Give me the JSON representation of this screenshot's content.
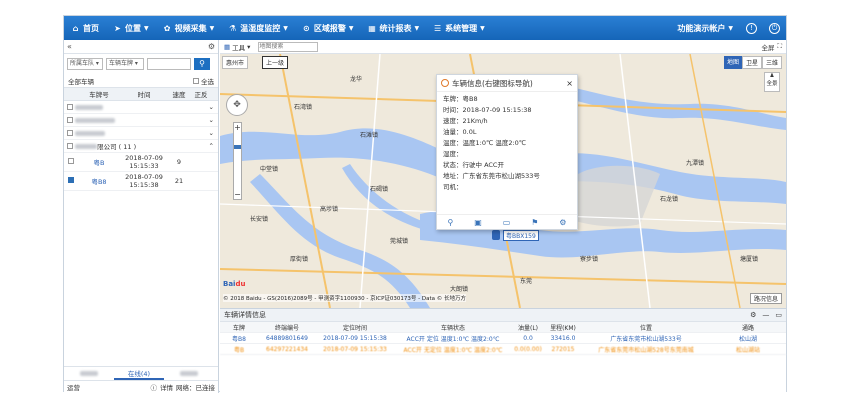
{
  "nav": {
    "items": [
      {
        "icon": "home-icon",
        "glyph": "⌂",
        "label": "首页",
        "caret": false
      },
      {
        "icon": "location-icon",
        "glyph": "➤",
        "label": "位置",
        "caret": true
      },
      {
        "icon": "video-icon",
        "glyph": "✿",
        "label": "视频采集",
        "caret": true
      },
      {
        "icon": "thermometer-icon",
        "glyph": "⚗",
        "label": "温湿度监控",
        "caret": true
      },
      {
        "icon": "region-icon",
        "glyph": "⊙",
        "label": "区域报警",
        "caret": true
      },
      {
        "icon": "report-icon",
        "glyph": "▦",
        "label": "统计报表",
        "caret": true
      },
      {
        "icon": "settings-icon",
        "glyph": "☰",
        "label": "系统管理",
        "caret": true
      }
    ],
    "account": "功能演示帐户"
  },
  "left": {
    "filter_1": "所属车队",
    "filter_2": "车辆车牌",
    "all_vehicles": "全部车辆",
    "select_all": "全选",
    "headers": [
      "车牌号",
      "时间",
      "速度",
      "正反"
    ],
    "company_group": "限公司 ( 11 )",
    "rows": [
      {
        "plate": "粤B",
        "date": "2018-07-09",
        "time": "15:15:33",
        "speed": "9",
        "checked": false
      },
      {
        "plate": "粤B8",
        "date": "2018-07-09",
        "time": "15:15:38",
        "speed": "21",
        "checked": true
      }
    ],
    "tab_online": "在线(4)",
    "status_label": "运营",
    "status_detail": "详情",
    "status_net": "网络：已连接"
  },
  "map_toolbar": {
    "tools_label": "工具",
    "search_placeholder": "地图搜索",
    "fullscreen": "全屏"
  },
  "map": {
    "tabs": [
      "地图",
      "卫星",
      "三维"
    ],
    "fullview": "全景",
    "city_tab": "惠州市",
    "level_tab": "上一级",
    "copyright": "© 2018 Baidu - GS(2016)2089号 - 甲测资字1100930 - 京ICP证030173号 - Data © 长地万方",
    "info_label": "路况信息",
    "marker_label": "粤BBX159",
    "places": [
      "石湾镇",
      "龙华",
      "石滩镇",
      "九潭镇",
      "东莞",
      "中堂镇",
      "石龙镇",
      "塘厦镇",
      "厚街镇",
      "石碣镇",
      "莞城镇",
      "高埗镇",
      "寮步镇",
      "大朗镇",
      "长安镇"
    ]
  },
  "popup": {
    "title": "车辆信息(右键图标导航)",
    "lines": [
      "车牌：粤B8",
      "时间：2018-07-09 15:15:38",
      "速度：21Km/h",
      "油量：0.0L",
      "温度：温度1:0℃ 温度2:0℃",
      "湿度：",
      "状态：行驶中 ACC开",
      "地址：广东省东莞市松山湖533号",
      "司机："
    ]
  },
  "detail": {
    "title": "车辆详情信息",
    "headers": [
      "车牌",
      "终端编号",
      "定位时间",
      "车辆状态",
      "油量(L)",
      "里程(KM)",
      "位置",
      "通路"
    ],
    "rows": [
      {
        "plate": "粤B8",
        "terminal": "64889801649",
        "time": "2018-07-09 15:15:38",
        "status": "ACC开 定位 温度1:0℃ 温度2:0℃",
        "fuel": "0.0",
        "mileage": "33416.0",
        "location": "广东省东莞市松山湖533号",
        "channel": "松山湖"
      },
      {
        "plate": "粤B",
        "terminal": "64297221434",
        "time": "2018-07-09 15:15:33",
        "status": "ACC开 无定位 温度1:0℃ 温度2:0℃",
        "fuel": "0.0(0.00)",
        "mileage": "272015",
        "location": "广东省东莞市松山湖528号东莞南城",
        "channel": "松山湖站"
      }
    ]
  }
}
